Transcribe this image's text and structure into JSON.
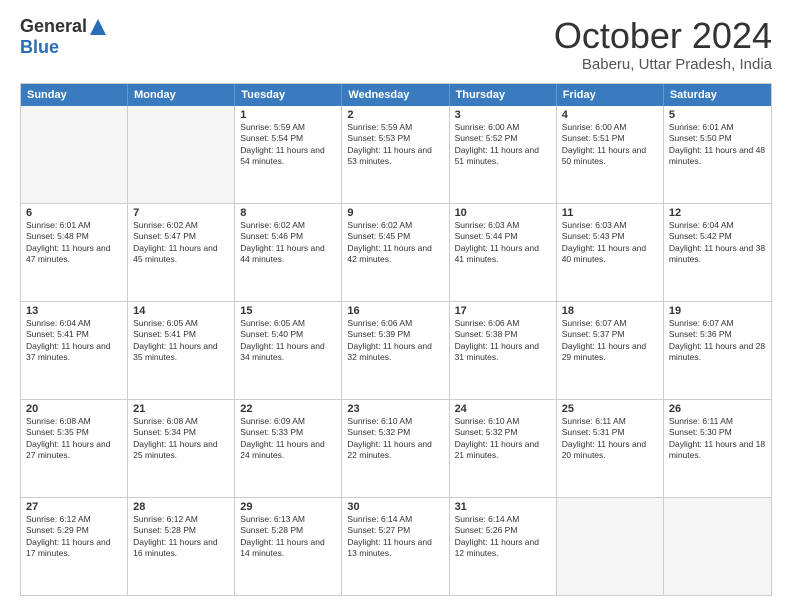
{
  "header": {
    "logo_general": "General",
    "logo_blue": "Blue",
    "month": "October 2024",
    "location": "Baberu, Uttar Pradesh, India"
  },
  "days_of_week": [
    "Sunday",
    "Monday",
    "Tuesday",
    "Wednesday",
    "Thursday",
    "Friday",
    "Saturday"
  ],
  "weeks": [
    [
      {
        "day": "",
        "info": ""
      },
      {
        "day": "",
        "info": ""
      },
      {
        "day": "1",
        "info": "Sunrise: 5:59 AM\nSunset: 5:54 PM\nDaylight: 11 hours and 54 minutes."
      },
      {
        "day": "2",
        "info": "Sunrise: 5:59 AM\nSunset: 5:53 PM\nDaylight: 11 hours and 53 minutes."
      },
      {
        "day": "3",
        "info": "Sunrise: 6:00 AM\nSunset: 5:52 PM\nDaylight: 11 hours and 51 minutes."
      },
      {
        "day": "4",
        "info": "Sunrise: 6:00 AM\nSunset: 5:51 PM\nDaylight: 11 hours and 50 minutes."
      },
      {
        "day": "5",
        "info": "Sunrise: 6:01 AM\nSunset: 5:50 PM\nDaylight: 11 hours and 48 minutes."
      }
    ],
    [
      {
        "day": "6",
        "info": "Sunrise: 6:01 AM\nSunset: 5:48 PM\nDaylight: 11 hours and 47 minutes."
      },
      {
        "day": "7",
        "info": "Sunrise: 6:02 AM\nSunset: 5:47 PM\nDaylight: 11 hours and 45 minutes."
      },
      {
        "day": "8",
        "info": "Sunrise: 6:02 AM\nSunset: 5:46 PM\nDaylight: 11 hours and 44 minutes."
      },
      {
        "day": "9",
        "info": "Sunrise: 6:02 AM\nSunset: 5:45 PM\nDaylight: 11 hours and 42 minutes."
      },
      {
        "day": "10",
        "info": "Sunrise: 6:03 AM\nSunset: 5:44 PM\nDaylight: 11 hours and 41 minutes."
      },
      {
        "day": "11",
        "info": "Sunrise: 6:03 AM\nSunset: 5:43 PM\nDaylight: 11 hours and 40 minutes."
      },
      {
        "day": "12",
        "info": "Sunrise: 6:04 AM\nSunset: 5:42 PM\nDaylight: 11 hours and 38 minutes."
      }
    ],
    [
      {
        "day": "13",
        "info": "Sunrise: 6:04 AM\nSunset: 5:41 PM\nDaylight: 11 hours and 37 minutes."
      },
      {
        "day": "14",
        "info": "Sunrise: 6:05 AM\nSunset: 5:41 PM\nDaylight: 11 hours and 35 minutes."
      },
      {
        "day": "15",
        "info": "Sunrise: 6:05 AM\nSunset: 5:40 PM\nDaylight: 11 hours and 34 minutes."
      },
      {
        "day": "16",
        "info": "Sunrise: 6:06 AM\nSunset: 5:39 PM\nDaylight: 11 hours and 32 minutes."
      },
      {
        "day": "17",
        "info": "Sunrise: 6:06 AM\nSunset: 5:38 PM\nDaylight: 11 hours and 31 minutes."
      },
      {
        "day": "18",
        "info": "Sunrise: 6:07 AM\nSunset: 5:37 PM\nDaylight: 11 hours and 29 minutes."
      },
      {
        "day": "19",
        "info": "Sunrise: 6:07 AM\nSunset: 5:36 PM\nDaylight: 11 hours and 28 minutes."
      }
    ],
    [
      {
        "day": "20",
        "info": "Sunrise: 6:08 AM\nSunset: 5:35 PM\nDaylight: 11 hours and 27 minutes."
      },
      {
        "day": "21",
        "info": "Sunrise: 6:08 AM\nSunset: 5:34 PM\nDaylight: 11 hours and 25 minutes."
      },
      {
        "day": "22",
        "info": "Sunrise: 6:09 AM\nSunset: 5:33 PM\nDaylight: 11 hours and 24 minutes."
      },
      {
        "day": "23",
        "info": "Sunrise: 6:10 AM\nSunset: 5:32 PM\nDaylight: 11 hours and 22 minutes."
      },
      {
        "day": "24",
        "info": "Sunrise: 6:10 AM\nSunset: 5:32 PM\nDaylight: 11 hours and 21 minutes."
      },
      {
        "day": "25",
        "info": "Sunrise: 6:11 AM\nSunset: 5:31 PM\nDaylight: 11 hours and 20 minutes."
      },
      {
        "day": "26",
        "info": "Sunrise: 6:11 AM\nSunset: 5:30 PM\nDaylight: 11 hours and 18 minutes."
      }
    ],
    [
      {
        "day": "27",
        "info": "Sunrise: 6:12 AM\nSunset: 5:29 PM\nDaylight: 11 hours and 17 minutes."
      },
      {
        "day": "28",
        "info": "Sunrise: 6:12 AM\nSunset: 5:28 PM\nDaylight: 11 hours and 16 minutes."
      },
      {
        "day": "29",
        "info": "Sunrise: 6:13 AM\nSunset: 5:28 PM\nDaylight: 11 hours and 14 minutes."
      },
      {
        "day": "30",
        "info": "Sunrise: 6:14 AM\nSunset: 5:27 PM\nDaylight: 11 hours and 13 minutes."
      },
      {
        "day": "31",
        "info": "Sunrise: 6:14 AM\nSunset: 5:26 PM\nDaylight: 11 hours and 12 minutes."
      },
      {
        "day": "",
        "info": ""
      },
      {
        "day": "",
        "info": ""
      }
    ]
  ]
}
